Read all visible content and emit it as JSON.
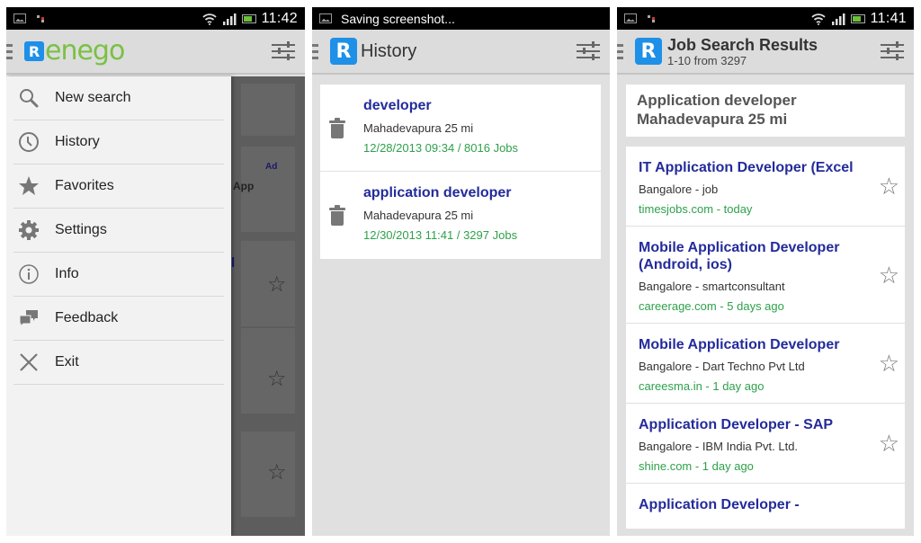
{
  "screens": {
    "drawer": {
      "status": {
        "time": "11:42"
      },
      "brand": {
        "logo_letter": "R",
        "name": "enego"
      },
      "menu": [
        {
          "label": "New search",
          "icon": "search-icon"
        },
        {
          "label": "History",
          "icon": "clock-icon"
        },
        {
          "label": "Favorites",
          "icon": "star-icon"
        },
        {
          "label": "Settings",
          "icon": "gear-icon"
        },
        {
          "label": "Info",
          "icon": "info-icon"
        },
        {
          "label": "Feedback",
          "icon": "chat-bubbles-icon"
        },
        {
          "label": "Exit",
          "icon": "close-icon"
        }
      ],
      "background": {
        "ad_label": "Ad",
        "app_text": "App",
        "title_fragment": "l"
      }
    },
    "history": {
      "status": {
        "notification": "Saving screenshot..."
      },
      "title": "History",
      "logo_letter": "R",
      "items": [
        {
          "query": "developer",
          "location": "Mahadevapura  25 mi",
          "meta": "12/28/2013 09:34  /  8016  Jobs"
        },
        {
          "query": "application developer",
          "location": "Mahadevapura  25 mi",
          "meta": "12/30/2013 11:41  /  3297  Jobs"
        }
      ]
    },
    "results": {
      "status": {
        "time": "11:41"
      },
      "title": "Job Search Results",
      "subtitle": "1-10 from 3297",
      "logo_letter": "R",
      "query": {
        "line1": "Application developer",
        "line2": "Mahadevapura 25 mi"
      },
      "jobs": [
        {
          "title": "IT Application Developer (Excel",
          "company": "Bangalore - job",
          "source": "timesjobs.com - today"
        },
        {
          "title": "Mobile Application Developer (Android, ios)",
          "company": "Bangalore - smartconsultant",
          "source": "careerage.com - 5 days ago"
        },
        {
          "title": "Mobile Application Developer",
          "company": "Bangalore - Dart Techno Pvt Ltd",
          "source": "careesma.in - 1 day ago"
        },
        {
          "title": "Application Developer - SAP",
          "company": "Bangalore - IBM India Pvt. Ltd.",
          "source": "shine.com - 1 day ago"
        },
        {
          "title": "Application Developer -",
          "company": "",
          "source": ""
        }
      ]
    }
  },
  "colors": {
    "brand_blue": "#1e90e8",
    "brand_green": "#7ac143",
    "link_blue": "#232b9b",
    "meta_green": "#2ea14b"
  }
}
